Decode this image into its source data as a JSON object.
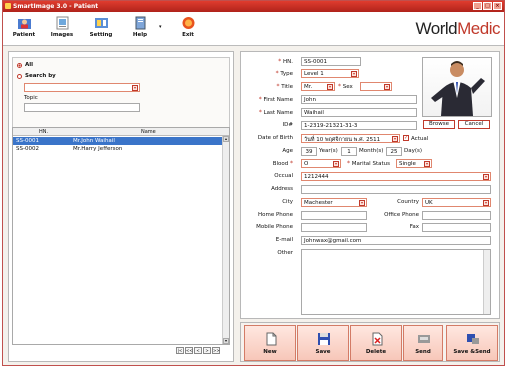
{
  "window": {
    "title": "SmartImage 3.0 - Patient"
  },
  "toolbar": {
    "patient": "Patient",
    "images": "Images",
    "setting": "Setting",
    "help": "Help",
    "exit": "Exit",
    "logo_a": "World",
    "logo_b": "Medic"
  },
  "filter": {
    "all_label": "All",
    "search_label": "Search by",
    "topic_label": "Topic",
    "search_value": "",
    "topic_value": ""
  },
  "patients": {
    "columns": [
      "HN.",
      "Name"
    ],
    "rows": [
      {
        "hn": "SS-0001",
        "name": "Mr.John Waihail"
      },
      {
        "hn": "SS-0002",
        "name": "Mr.Harry Jefferson"
      }
    ],
    "pager": [
      "|<",
      "<<",
      "<",
      ">",
      ">>"
    ]
  },
  "form": {
    "hn_label": "HN.",
    "hn_value": "SS-0001",
    "type_label": "Type",
    "type_value": "Level 1",
    "title_label": "Title",
    "title_value": "Mr.",
    "sex_label": "Sex",
    "sex_value": "",
    "first_name_label": "First Name",
    "first_name_value": "John",
    "last_name_label": "Last Name",
    "last_name_value": "Waihail",
    "id_label": "ID#",
    "id_value": "1-2319-21321-31-3",
    "dob_label": "Date of Birth",
    "dob_value": "วันที่ 10 พฤศจิกายน พ.ศ. 2511",
    "actual_label": "Actual",
    "age_label": "Age",
    "age_years": "39",
    "years_label": "Year(s)",
    "age_months": "1",
    "months_label": "Month(s)",
    "age_days": "25",
    "days_label": "Day(s)",
    "blood_label": "Blood",
    "blood_value": "O",
    "marital_label": "Marital Status",
    "marital_value": "Single",
    "occupation_label": "Occual",
    "occupation_value": "1212444",
    "address_label": "Address",
    "address_value": "",
    "city_label": "City",
    "city_value": "Machester",
    "country_label": "Country",
    "country_value": "UK",
    "home_phone_label": "Home Phone",
    "home_phone_value": "",
    "office_phone_label": "Office Phone",
    "office_phone_value": "",
    "mobile_label": "Mobile Phone",
    "mobile_value": "",
    "fax_label": "Fax",
    "fax_value": "",
    "email_label": "E-mail",
    "email_value": "Johnwax@gmail.com",
    "other_label": "Other",
    "browse": "Browse",
    "cancel": "Cancel"
  },
  "actions": {
    "new": "New",
    "save": "Save",
    "delete": "Delete",
    "send": "Send",
    "save_send": "Save &Send"
  },
  "colors": {
    "accent": "#c0392b",
    "selection": "#3a74c9",
    "title_bar": "#c8302a"
  }
}
